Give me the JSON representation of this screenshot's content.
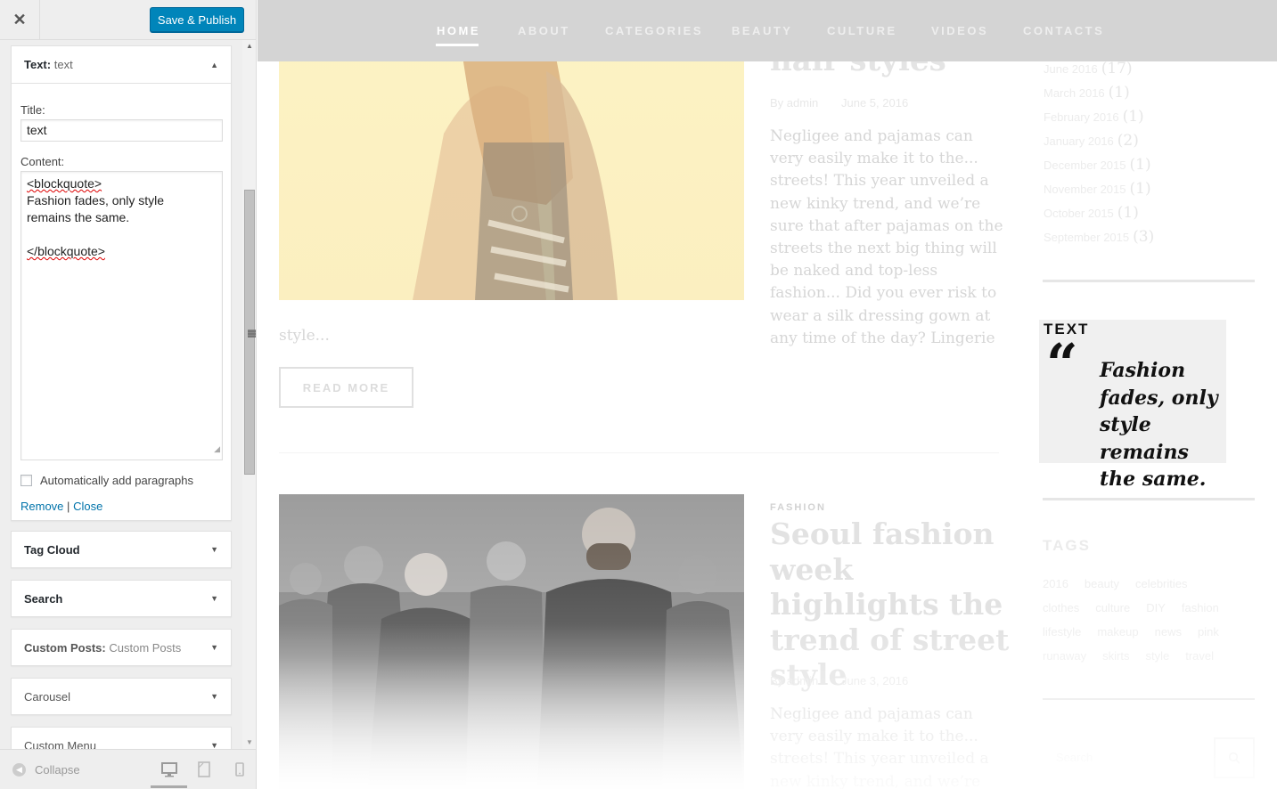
{
  "panel": {
    "close_label": "✕",
    "save_label": "Save & Publish",
    "text_widget": {
      "name": "Text:",
      "subtitle": "text",
      "title_label": "Title:",
      "title_value": "text",
      "content_label": "Content:",
      "content_line1": "<blockquote>",
      "content_line2": "Fashion fades, only style",
      "content_line3": "remains the same.",
      "content_line5": "</blockquote>",
      "autop_label": "Automatically add paragraphs",
      "remove_label": "Remove",
      "separator": "|",
      "close_label": "Close"
    },
    "widgets": [
      {
        "name": "Tag Cloud",
        "subtitle": ""
      },
      {
        "name": "Search",
        "subtitle": ""
      },
      {
        "name": "Custom Posts:",
        "subtitle": "Custom Posts"
      },
      {
        "name": "Carousel",
        "subtitle": ""
      },
      {
        "name": "Custom Menu",
        "subtitle": ""
      }
    ],
    "footer": {
      "collapse_label": "Collapse"
    }
  },
  "site": {
    "nav": [
      "HOME",
      "ABOUT",
      "CATEGORIES",
      "BEAUTY",
      "CULTURE",
      "VIDEOS",
      "CONTACTS"
    ],
    "post1": {
      "title_fragment": "hair styles",
      "author": "By admin",
      "date": "June 5, 2016",
      "excerpt": "Negligee and pajamas can very easily make it to the... streets! This year unveiled a new kinky trend, and we’re sure that after pajamas on the streets the next big thing will be naked and top-less fashion... Did you ever risk to wear a silk dressing gown at any time of the day? Lingerie",
      "excerpt_more": "style...",
      "read_more": "READ MORE"
    },
    "post2": {
      "category": "FASHION",
      "title": "Seoul fashion week highlights the trend of street style",
      "author": "By admin",
      "date": "June 3, 2016",
      "excerpt": "Negligee and pajamas can very easily make it to the... streets! This year unveiled a new kinky trend, and we’re sure that after"
    },
    "archives": [
      {
        "label": "June 2016",
        "count": "(17)"
      },
      {
        "label": "March 2016",
        "count": "(1)"
      },
      {
        "label": "February 2016",
        "count": "(1)"
      },
      {
        "label": "January 2016",
        "count": "(2)"
      },
      {
        "label": "December 2015",
        "count": "(1)"
      },
      {
        "label": "November 2015",
        "count": "(1)"
      },
      {
        "label": "October 2015",
        "count": "(1)"
      },
      {
        "label": "September 2015",
        "count": "(3)"
      }
    ],
    "text_widget": {
      "title": "TEXT",
      "quote_mark": "“",
      "quote": "Fashion fades, only style remains the same."
    },
    "tags_title": "TAGS",
    "tags": [
      "2016",
      "beauty",
      "celebrities",
      "clothes",
      "culture",
      "DIY",
      "fashion",
      "lifestyle",
      "makeup",
      "news",
      "pink",
      "runaway",
      "skirts",
      "style",
      "travel"
    ],
    "search_placeholder": "Search"
  },
  "colors": {
    "accent": "#0085ba",
    "nav_bg": "#d4d4d4",
    "panel_bg": "#eeeeee"
  }
}
